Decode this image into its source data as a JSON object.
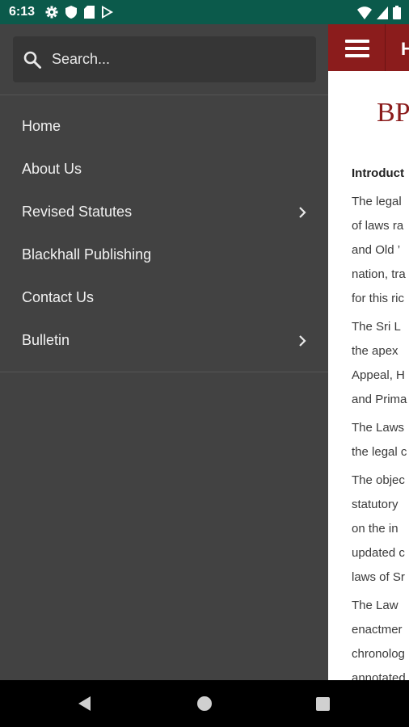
{
  "status_bar": {
    "time": "6:13",
    "left_icons": [
      "gear-icon",
      "shield-icon",
      "sim-card-icon",
      "play-store-icon"
    ],
    "right_icons": [
      "wifi-icon",
      "signal-icon",
      "battery-icon"
    ]
  },
  "drawer": {
    "search_placeholder": "Search...",
    "items": [
      {
        "label": "Home",
        "has_submenu": false
      },
      {
        "label": "About Us",
        "has_submenu": false
      },
      {
        "label": "Revised Statutes",
        "has_submenu": true
      },
      {
        "label": "Blackhall Publishing",
        "has_submenu": false
      },
      {
        "label": "Contact Us",
        "has_submenu": false
      },
      {
        "label": "Bulletin",
        "has_submenu": true
      }
    ]
  },
  "app": {
    "title_partial": "H",
    "logo_text": "BP",
    "heading": "Introduct",
    "paragraphs": [
      [
        "The legal",
        "of laws ra",
        "and Old ’",
        "nation, tra",
        "for this ric"
      ],
      [
        "The Sri L",
        "the apex",
        "Appeal, H",
        "and Prima"
      ],
      [
        "The Laws",
        "the legal c"
      ],
      [
        "The objec",
        "statutory",
        "on the in",
        "updated c",
        "laws of Sr"
      ],
      [
        "The Law",
        "enactmer",
        "chronolog",
        "annotated"
      ]
    ]
  },
  "colors": {
    "status_bar": "#0b5a4b",
    "drawer_bg": "#424242",
    "search_bg": "#363636",
    "app_bar": "#8b1c1c",
    "logo": "#8b1c1c"
  },
  "nav_bar": {
    "icons": [
      "back-icon",
      "home-icon",
      "recents-icon"
    ]
  }
}
